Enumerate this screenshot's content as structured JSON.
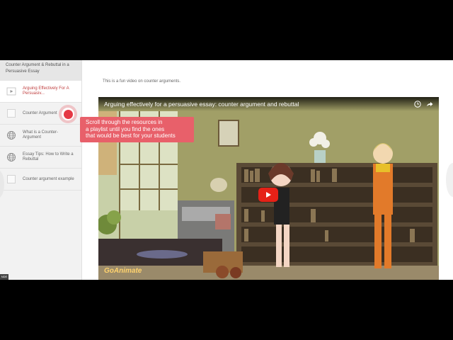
{
  "playlist": {
    "title": "Counter Argument & Rebuttal in a Persuasive Essay",
    "items": [
      {
        "label": "Arguing Effectively For A Persuasiv...",
        "icon": "video-icon"
      },
      {
        "label": "Counter Argument",
        "icon": "document-icon"
      },
      {
        "label": "What is a Counter-Argument",
        "icon": "globe-icon"
      },
      {
        "label": "Essay Tips: How to Write a Rebuttal",
        "icon": "globe-icon"
      },
      {
        "label": "Counter argument example",
        "icon": "document-icon"
      }
    ]
  },
  "tooltip": {
    "line1": "Scroll through the resources in",
    "line2": "a playlist until you find the ones",
    "line3": "that would be best for your students"
  },
  "main": {
    "description": "This is a fun video on counter arguments.",
    "video": {
      "title": "Arguing effectively for a persuasive essay: counter argument and rebuttal",
      "watermark": "GoAnimate"
    }
  },
  "edge_tag": "NDE",
  "colors": {
    "accent_red": "#e53945",
    "tooltip_bg": "#e8606a",
    "youtube_red": "#e62117"
  }
}
